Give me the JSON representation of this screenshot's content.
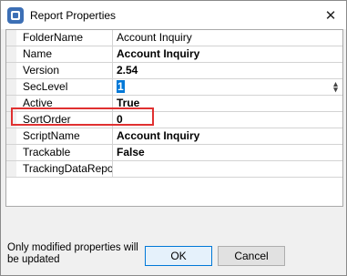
{
  "window": {
    "title": "Report Properties",
    "close_glyph": "✕"
  },
  "properties": [
    {
      "name": "FolderName",
      "value": "Account Inquiry",
      "bold": false
    },
    {
      "name": "Name",
      "value": "Account Inquiry",
      "bold": true
    },
    {
      "name": "Version",
      "value": "2.54",
      "bold": true
    },
    {
      "name": "SecLevel",
      "value": "1",
      "bold": true,
      "editing": true
    },
    {
      "name": "Active",
      "value": "True",
      "bold": true
    },
    {
      "name": "SortOrder",
      "value": "0",
      "bold": true
    },
    {
      "name": "ScriptName",
      "value": "Account Inquiry",
      "bold": true
    },
    {
      "name": "Trackable",
      "value": "False",
      "bold": true
    },
    {
      "name": "TrackingDataReport",
      "value": "",
      "bold": false
    }
  ],
  "footer": {
    "note": "Only modified properties will be updated",
    "ok_label": "OK",
    "cancel_label": "Cancel"
  },
  "colors": {
    "selection": "#0078d7",
    "highlight_border": "#e03030"
  }
}
